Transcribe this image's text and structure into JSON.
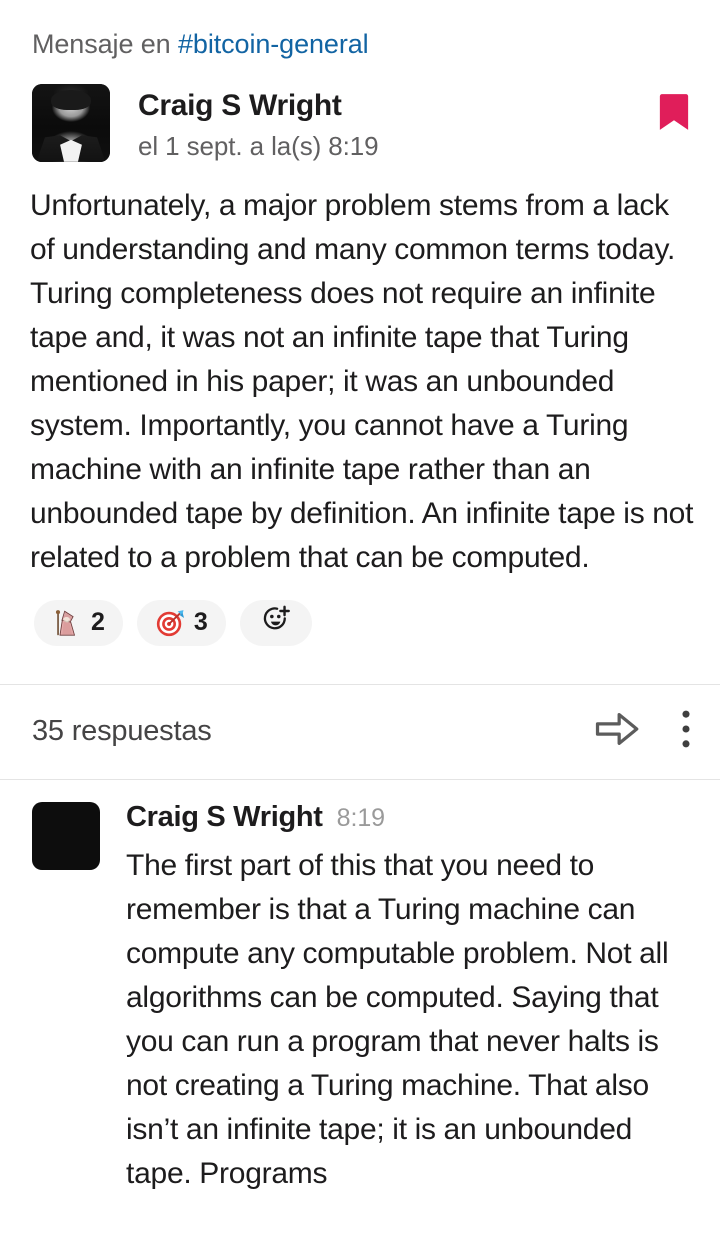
{
  "header": {
    "prefix": "Mensaje en ",
    "channel": "#bitcoin-general",
    "channel_link_color": "#1264a3"
  },
  "root_message": {
    "sender": "Craig S Wright",
    "timestamp": "el 1 sept. a la(s) 8:19",
    "avatar_alt": "Craig S Wright avatar",
    "saved_icon": "bookmark-icon",
    "saved_icon_color": "#e01e5a",
    "body": "Unfortunately, a major problem stems from a lack of understanding and many common terms today. Turing completeness does not require an infinite tape and, it was not an infinite tape that Turing mentioned in his paper; it was an unbounded system. Importantly, you cannot have a Turing machine with an infinite tape rather than an unbounded tape by definition. An infinite tape is not related to a problem that can be computed.",
    "reactions": [
      {
        "emoji": "mage-icon",
        "name": "wizard",
        "count": "2"
      },
      {
        "emoji": "dart-icon",
        "name": "dart",
        "count": "3"
      }
    ],
    "add_reaction_label": "add-reaction-icon"
  },
  "thread": {
    "replies_label": "35 respuestas",
    "share_icon": "share-arrow-icon",
    "more_icon": "more-options-icon"
  },
  "reply": {
    "sender": "Craig S Wright",
    "timestamp": "8:19",
    "body": "The first part of this that you need to remember is that a Turing machine can compute any computable problem. Not all algorithms can be computed. Saying that you can run a program that never halts is not creating a Turing machine. That also isn’t an infinite tape; it is an unbounded tape. Programs"
  }
}
